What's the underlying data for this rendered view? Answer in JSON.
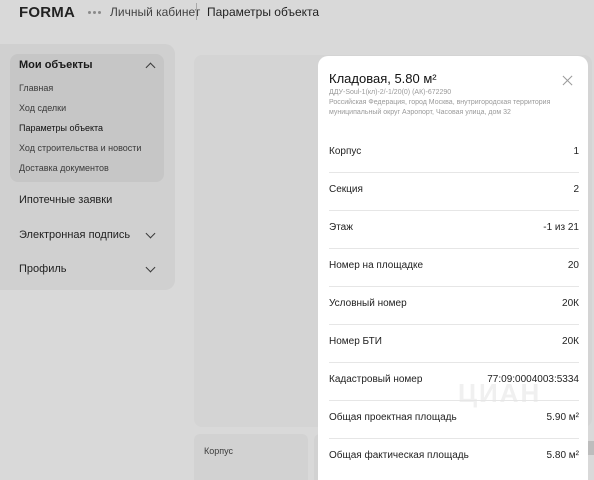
{
  "header": {
    "logo": "FORMA",
    "breadcrumb_account": "Личный кабинет",
    "breadcrumb_current": "Параметры объекта"
  },
  "sidebar": {
    "section_title": "Мои объекты",
    "sub_items": [
      {
        "label": "Главная"
      },
      {
        "label": "Ход сделки"
      },
      {
        "label": "Параметры объекта"
      },
      {
        "label": "Ход строительства и новости"
      },
      {
        "label": "Доставка документов"
      }
    ],
    "items": [
      {
        "label": "Ипотечные заявки"
      },
      {
        "label": "Электронная подпись"
      },
      {
        "label": "Профиль"
      }
    ]
  },
  "background": {
    "card_label": "Корпус"
  },
  "modal": {
    "title": "Кладовая, 5.80 м²",
    "contract": "ДДУ-Soul-1(кл)-2/-1/20(0) (АК)-672290",
    "address": "Российская Федерация, город Москва, внутригородская территория муниципальный округ Аэропорт, Часовая улица, дом 32",
    "rows": [
      {
        "label": "Корпус",
        "value": "1"
      },
      {
        "label": "Секция",
        "value": "2"
      },
      {
        "label": "Этаж",
        "value": "-1 из 21"
      },
      {
        "label": "Номер на площадке",
        "value": "20"
      },
      {
        "label": "Условный номер",
        "value": "20К"
      },
      {
        "label": "Номер БТИ",
        "value": "20К"
      },
      {
        "label": "Кадастровый номер",
        "value": "77:09:0004003:5334"
      },
      {
        "label": "Общая проектная площадь",
        "value": "5.90 м²"
      },
      {
        "label": "Общая фактическая площадь",
        "value": "5.80 м²"
      }
    ]
  },
  "colors": {
    "overlay": "#d9d9d9",
    "modal_bg": "#ffffff",
    "muted_text": "#9a9a9a"
  }
}
